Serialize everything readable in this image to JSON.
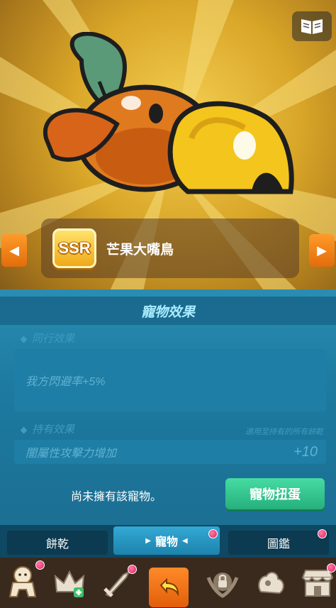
{
  "pet": {
    "rarity": "SSR",
    "name": "芒果大嘴鳥"
  },
  "panel": {
    "title": "寵物效果",
    "companion_label": "同行效果",
    "companion_effect": "我方閃避率+5%",
    "holding_label": "持有效果",
    "holding_note": "適用至持有的所有餅乾",
    "holding_effect": "闇屬性攻擊力增加",
    "holding_value": "+10",
    "not_owned_text": "尚未擁有該寵物。",
    "gacha_button": "寵物扭蛋"
  },
  "subtabs": {
    "cookies": "餅乾",
    "pets": "寵物",
    "collection": "圖鑑"
  },
  "colors": {
    "accent_green": "#26b07d",
    "accent_orange": "#e26d0c",
    "badge_pink": "#e0205e"
  },
  "icons": {
    "book": "book-icon",
    "left_arrow": "triangle-left-icon",
    "right_arrow": "triangle-right-icon",
    "nav": [
      "cookie-icon",
      "crown-icon",
      "sword-icon",
      "back-arrow-icon",
      "lock-icon",
      "treasure-icon",
      "shop-icon"
    ]
  }
}
